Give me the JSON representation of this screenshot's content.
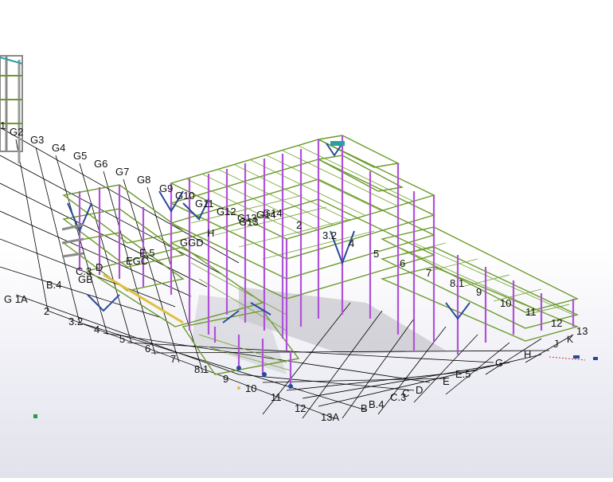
{
  "model": {
    "colors": {
      "grid_line": "#000000",
      "column": "#b052d8",
      "beam": "#6a9a2a",
      "brace": "#2a4a9a",
      "secondary": "#8a8a8a",
      "highlight": "#e0c040",
      "slab_shadow": "#b0b0b8",
      "label": "#111111"
    },
    "grid_labels_g_series": [
      "1",
      "G2",
      "G3",
      "G4",
      "G5",
      "G6",
      "G7",
      "G8",
      "G9",
      "G10",
      "G11",
      "G12",
      "G13",
      "G14"
    ],
    "grid_labels_front_numbers": [
      "2",
      "3.2",
      "4",
      "5",
      "6",
      "7",
      "8.1",
      "9",
      "10",
      "11",
      "12",
      "13A"
    ],
    "grid_labels_front_letters": [
      "B",
      "B.4",
      "C.3",
      "C",
      "D",
      "E",
      "E.5",
      "G",
      "H",
      "J",
      "K"
    ],
    "grid_labels_right_numbers": [
      "2",
      "3.2",
      "4",
      "5",
      "6",
      "7",
      "8.1",
      "9",
      "10",
      "11",
      "12",
      "13"
    ],
    "grid_labels_interior": [
      "H",
      "GGD",
      "EGC",
      "E.5",
      "G 1A",
      "B.4",
      "GB",
      "C.3",
      "D",
      "G13",
      "G14"
    ]
  }
}
